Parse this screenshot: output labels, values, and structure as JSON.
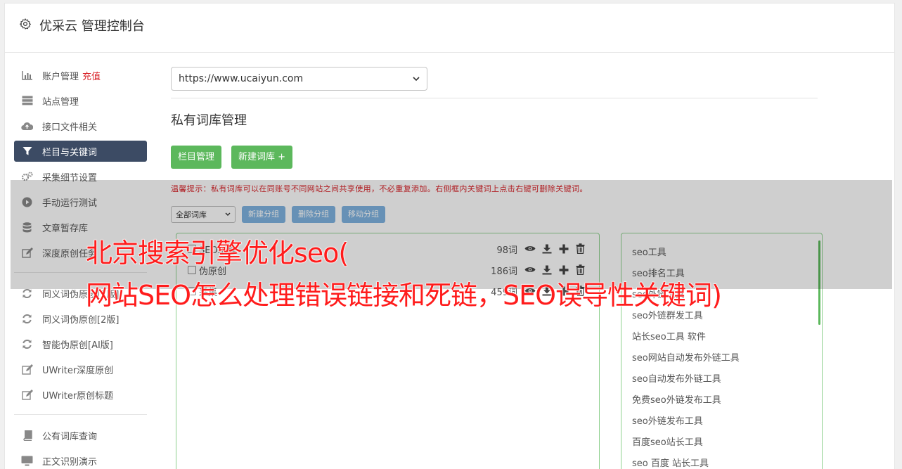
{
  "header": {
    "title": "优采云 管理控制台",
    "icon": "gear-icon"
  },
  "sidebar": {
    "items": [
      {
        "label": "账户管理",
        "extra": "充值",
        "icon": "bar-chart-icon"
      },
      {
        "label": "站点管理",
        "icon": "server-icon"
      },
      {
        "label": "接口文件相关",
        "icon": "cloud-upload-icon"
      },
      {
        "label": "栏目与关键词",
        "icon": "filter-icon",
        "active": true
      },
      {
        "label": "采集细节设置",
        "icon": "cogs-icon"
      },
      {
        "label": "手动运行测试",
        "icon": "play-circle-icon"
      },
      {
        "label": "文章暂存库",
        "icon": "database-icon"
      },
      {
        "label": "深度原创任务",
        "icon": "edit-icon"
      }
    ],
    "items2": [
      {
        "label": "同义词伪原创[1版]",
        "icon": "refresh-icon"
      },
      {
        "label": "同义词伪原创[2版]",
        "icon": "refresh-icon"
      },
      {
        "label": "智能伪原创[AI版]",
        "icon": "refresh-icon"
      },
      {
        "label": "UWriter深度原创",
        "icon": "edit-icon"
      },
      {
        "label": "UWriter原创标题",
        "icon": "edit-icon"
      }
    ],
    "items3": [
      {
        "label": "公有词库查询",
        "icon": "book-icon"
      },
      {
        "label": "正文识别演示",
        "icon": "monitor-icon"
      }
    ]
  },
  "main": {
    "site_select": "https://www.ucaiyun.com",
    "section_title": "私有词库管理",
    "btn_column": "栏目管理",
    "btn_new_lib": "新建词库 +",
    "tip": "温馨提示：私有词库可以在同账号不同网站之间共享使用，不必重复添加。右侧框内关键词上点击右键可删除关键词。",
    "lib_filter": "全部词库",
    "btn_new_group": "新建分组",
    "btn_del_group": "删除分组",
    "btn_move_group": "移动分组"
  },
  "libraries": [
    {
      "name": "SEO工具",
      "count": "98词"
    },
    {
      "name": "伪原创",
      "count": "186词"
    },
    {
      "name": "采集",
      "count": "459词"
    }
  ],
  "keywords": [
    "seo工具",
    "seo排名工具",
    "seo外链工具",
    "seo外链群发工具",
    "站长seo工具 软件",
    "seo网站自动发布外链工具",
    "seo自动发布外链工具",
    "免费seo外链发布工具",
    "seo外链发布工具",
    "百度seo站长工具",
    "seo 百度 站长工具"
  ],
  "overlay": {
    "line1": "北京搜索引擎优化seo(",
    "line2": "网站SEO怎么处理错误链接和死链，SEO误导性关键词)"
  }
}
